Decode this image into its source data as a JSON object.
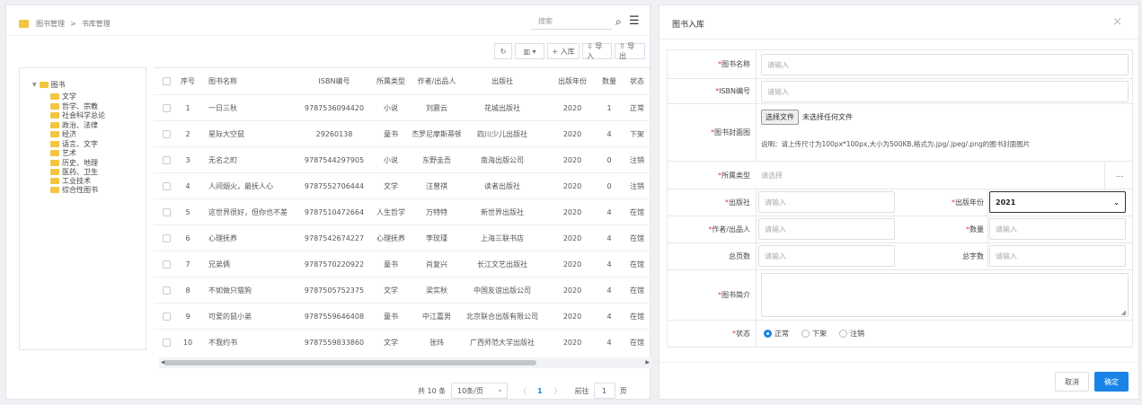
{
  "breadcrumb": {
    "root": "图书管理",
    "separator": ">",
    "current": "书库管理"
  },
  "search": {
    "placeholder": "搜索"
  },
  "toolbar": {
    "refresh": "↻",
    "columns": "▥ ▾",
    "add": "+ 入库",
    "import": "⇩ 导入",
    "export": "⇧ 导出"
  },
  "tree": {
    "root": "图书",
    "children": [
      "文学",
      "哲学、宗教",
      "社会科学总论",
      "政治、法律",
      "经济",
      "语言、文字",
      "艺术",
      "历史、地理",
      "医药、卫生",
      "工业技术",
      "综合性图书"
    ]
  },
  "table": {
    "headers": [
      "序号",
      "图书名称",
      "ISBN编号",
      "所属类型",
      "作者/出品人",
      "出版社",
      "出版年份",
      "数量",
      "状态"
    ],
    "rows": [
      [
        "1",
        "一日三秋",
        "9787536094420",
        "小说",
        "刘震云",
        "花城出版社",
        "2020",
        "1",
        "正常"
      ],
      [
        "2",
        "星际大空鼠",
        "29260138",
        "童书",
        "杰罗尼摩斯蒂顿",
        "四川少儿出版社",
        "2020",
        "4",
        "下架"
      ],
      [
        "3",
        "无名之町",
        "9787544297905",
        "小说",
        "东野圭吾",
        "南海出版公司",
        "2020",
        "0",
        "注销"
      ],
      [
        "4",
        "人间烟火，最抚人心",
        "9787552706444",
        "文学",
        "汪曾祺",
        "读者出版社",
        "2020",
        "0",
        "注销"
      ],
      [
        "5",
        "这世界很好，但你也不差",
        "9787510472664",
        "人生哲学",
        "万特特",
        "新世界出版社",
        "2020",
        "4",
        "在馆"
      ],
      [
        "6",
        "心理抚养",
        "9787542674227",
        "心理抚养",
        "李玫瑾",
        "上海三联书店",
        "2020",
        "4",
        "在馆"
      ],
      [
        "7",
        "兄弟俩",
        "9787570220922",
        "童书",
        "肖复兴",
        "长江文艺出版社",
        "2020",
        "4",
        "在馆"
      ],
      [
        "8",
        "不如做只猫狗",
        "9787505752375",
        "文学",
        "梁实秋",
        "中国友谊出版公司",
        "2020",
        "4",
        "在馆"
      ],
      [
        "9",
        "可爱的鼠小弟",
        "9787559646408",
        "童书",
        "中江嘉男",
        "北京联合出版有限公司",
        "2020",
        "4",
        "在馆"
      ],
      [
        "10",
        "不我约书",
        "9787559833860",
        "文学",
        "张炜",
        "广西师范大学出版社",
        "2020",
        "4",
        "在馆"
      ]
    ]
  },
  "pagination": {
    "total": "共 10 条",
    "page_size": "10条/页",
    "prev": "〈",
    "current": "1",
    "next": "〉",
    "goto_label": "前往",
    "goto_value": "1",
    "page_unit": "页"
  },
  "dialog": {
    "title": "图书入库",
    "close": "×",
    "fields": {
      "book_name": {
        "label": "图书名称",
        "placeholder": "请输入"
      },
      "isbn": {
        "label": "ISBN编号",
        "placeholder": "请输入"
      },
      "cover": {
        "label": "图书封面图",
        "choose_button": "选择文件",
        "no_file": "未选择任何文件",
        "hint": "说明：请上传尺寸为100px*100px,大小为500KB,格式为.jpg/.jpeg/.png的图书封面图片"
      },
      "category": {
        "label": "所属类型",
        "placeholder": "请选择",
        "more": "..."
      },
      "publisher": {
        "label": "出版社",
        "placeholder": "请输入"
      },
      "year": {
        "label": "出版年份",
        "value": "2021"
      },
      "author": {
        "label": "作者/出品人",
        "placeholder": "请输入"
      },
      "quantity": {
        "label": "数量",
        "placeholder": "请输入"
      },
      "pages": {
        "label": "总页数",
        "placeholder": "请输入"
      },
      "words": {
        "label": "总字数",
        "placeholder": "请输入"
      },
      "intro": {
        "label": "图书简介"
      },
      "status": {
        "label": "状态",
        "options": [
          "正常",
          "下架",
          "注销"
        ],
        "selected": "正常"
      }
    },
    "cancel": "取消",
    "confirm": "确定"
  },
  "colors": {
    "accent": "#1a84e6",
    "folder": "#f4c542",
    "required": "#e43b3b"
  }
}
